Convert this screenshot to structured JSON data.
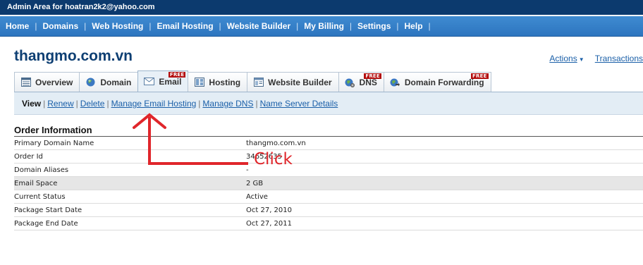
{
  "admin_bar": {
    "text": "Admin Area for hoatran2k2@yahoo.com"
  },
  "nav": {
    "items": [
      "Home",
      "Domains",
      "Web Hosting",
      "Email Hosting",
      "Website Builder",
      "My Billing",
      "Settings",
      "Help"
    ]
  },
  "domain": {
    "name": "thangmo.com.vn"
  },
  "header_links": {
    "actions": "Actions",
    "transactions": "Transactions"
  },
  "tabs": [
    {
      "label": "Overview",
      "icon": "overview-icon",
      "badge": ""
    },
    {
      "label": "Domain",
      "icon": "globe-icon",
      "badge": ""
    },
    {
      "label": "Email",
      "icon": "envelope-icon",
      "badge": "FREE",
      "active": true
    },
    {
      "label": "Hosting",
      "icon": "server-icon",
      "badge": ""
    },
    {
      "label": "Website Builder",
      "icon": "website-builder-icon",
      "badge": ""
    },
    {
      "label": "DNS",
      "icon": "dns-gear-icon",
      "badge": "FREE"
    },
    {
      "label": "Domain Forwarding",
      "icon": "forwarding-icon",
      "badge": "FREE"
    }
  ],
  "subnav": {
    "current": "View",
    "links": [
      "Renew",
      "Delete",
      "Manage Email Hosting",
      "Manage DNS",
      "Name Server Details"
    ],
    "separator": "|"
  },
  "order": {
    "title": "Order Information",
    "rows": [
      {
        "label": "Primary Domain Name",
        "value": "thangmo.com.vn"
      },
      {
        "label": "Order Id",
        "value": "34652635"
      },
      {
        "label": "Domain Aliases",
        "value": "-"
      },
      {
        "label": "Email Space",
        "value": "2 GB"
      },
      {
        "label": "Current Status",
        "value": "Active"
      },
      {
        "label": "Package Start Date",
        "value": "Oct 27, 2010"
      },
      {
        "label": "Package End Date",
        "value": "Oct 27, 2011"
      }
    ]
  },
  "annotation": {
    "text": "Click",
    "color": "#e0262b"
  },
  "colors": {
    "admin_bar": "#0c3a6e",
    "nav": "#2d75bf",
    "title": "#0e3f73",
    "link": "#1a5fa8",
    "badge": "#b30d0d"
  }
}
